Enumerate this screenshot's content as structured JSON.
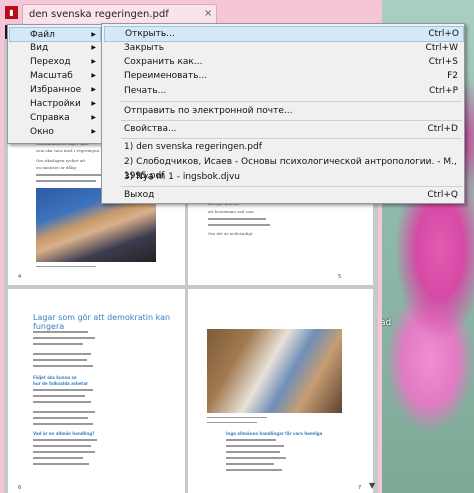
{
  "window": {
    "tab_title": "den svenska regeringen.pdf",
    "tab_close": "×"
  },
  "desktop": {
    "icon_label": "ad"
  },
  "main_menu": {
    "items": [
      {
        "label": "Файл"
      },
      {
        "label": "Вид"
      },
      {
        "label": "Переход"
      },
      {
        "label": "Масштаб"
      },
      {
        "label": "Избранное"
      },
      {
        "label": "Настройки"
      },
      {
        "label": "Справка"
      },
      {
        "label": "Окно"
      }
    ]
  },
  "file_menu": {
    "items": [
      {
        "label": "Открыть...",
        "shortcut": "Ctrl+O"
      },
      {
        "label": "Закрыть",
        "shortcut": "Ctrl+W"
      },
      {
        "label": "Сохранить как...",
        "shortcut": "Ctrl+S"
      },
      {
        "label": "Переименовать...",
        "shortcut": "F2"
      },
      {
        "label": "Печать...",
        "shortcut": "Ctrl+P"
      },
      {
        "label": "Отправить по электронной почте...",
        "shortcut": ""
      },
      {
        "label": "Свойства...",
        "shortcut": "Ctrl+D"
      },
      {
        "label": "1) den svenska regeringen.pdf",
        "shortcut": ""
      },
      {
        "label": "2) Слободчиков, Исаев - Основы психологической антропологии. - М., 1995.pdf",
        "shortcut": ""
      },
      {
        "label": "3) Nya m 1 - ingsbok.djvu",
        "shortcut": ""
      },
      {
        "label": "Выход",
        "shortcut": "Ctrl+Q"
      }
    ]
  },
  "document": {
    "page3_heading": "Lagar som gör att demokratin kan fungera",
    "page1_body": [
      "Statsministern väljer själv",
      "som ska vara med i regeringen.",
      "Om riksdagen tycker att",
      "en minister är dålig"
    ],
    "page2_body": [
      "Det går inte att",
      "att bestämma vad som",
      "Om det är nödvändigt"
    ],
    "page3_heads": [
      "Följet ska kunna se",
      "hur de folkvalda arbetar",
      "Vad är en allmän handling?"
    ],
    "page4_head": "Inga allmänna handlingar får vara hemliga",
    "page_numbers": [
      "4",
      "5",
      "6",
      "7"
    ]
  }
}
